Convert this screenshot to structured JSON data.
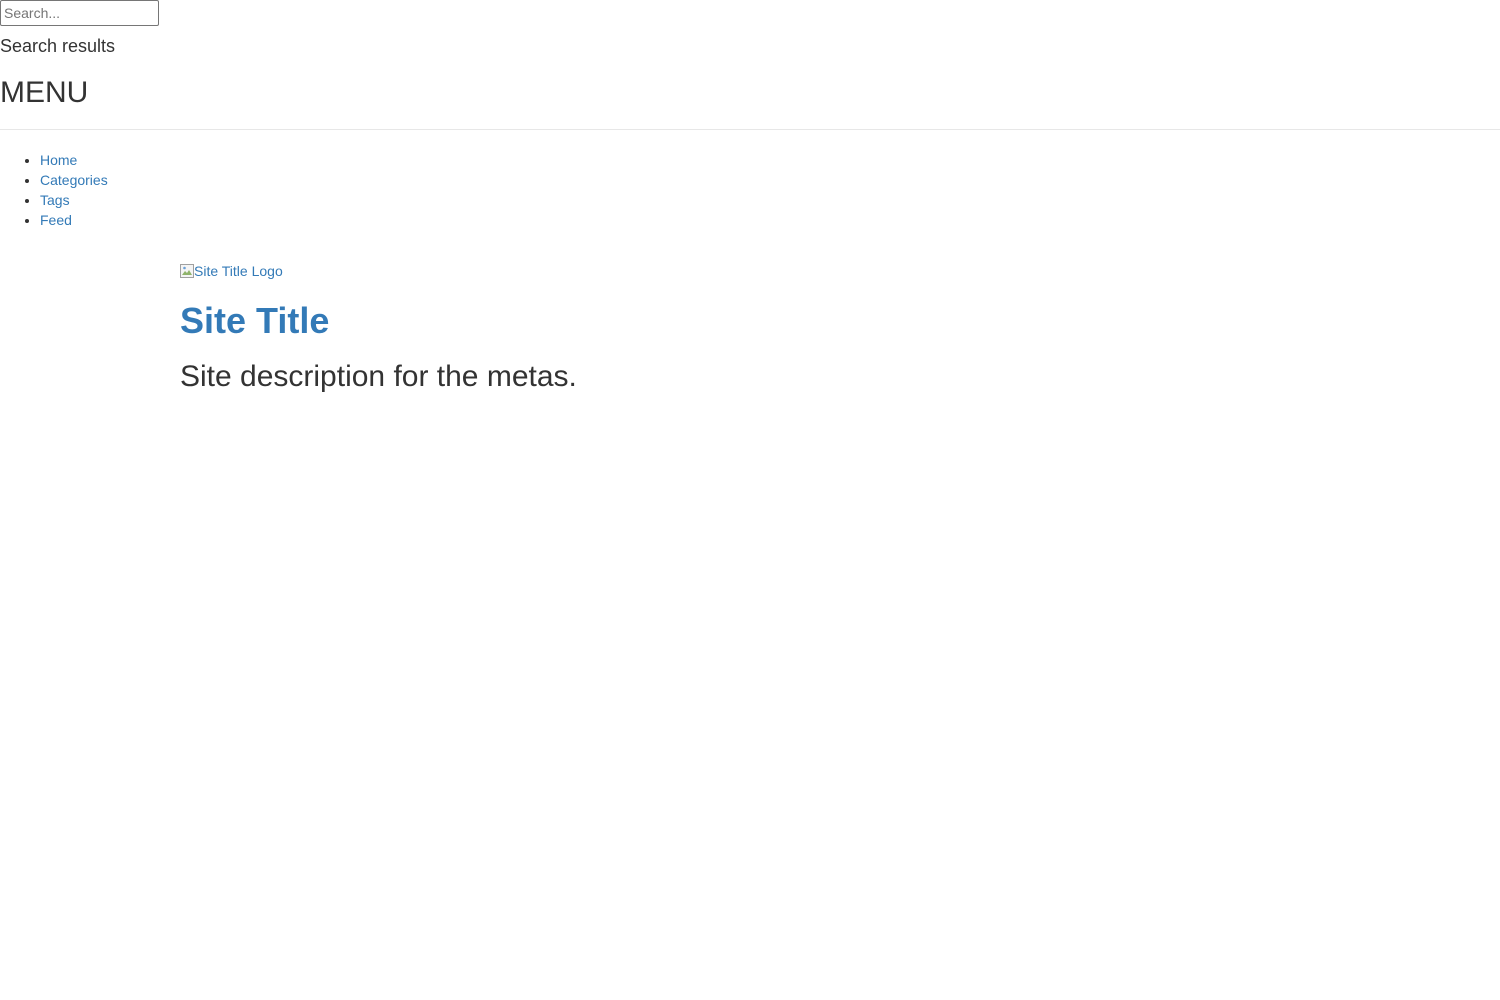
{
  "search": {
    "placeholder": "Search...",
    "value": "",
    "results_label": "Search results"
  },
  "menu": {
    "heading": "MENU",
    "items": [
      {
        "label": "Home"
      },
      {
        "label": "Categories"
      },
      {
        "label": "Tags"
      },
      {
        "label": "Feed"
      }
    ]
  },
  "header": {
    "logo_alt": "Site Title Logo",
    "title": "Site Title",
    "description": "Site description for the metas."
  },
  "colors": {
    "link": "#337ab7",
    "text": "#333333",
    "divider": "#e7e7e7"
  },
  "icons": {
    "logo_placeholder": "broken-image-icon"
  }
}
